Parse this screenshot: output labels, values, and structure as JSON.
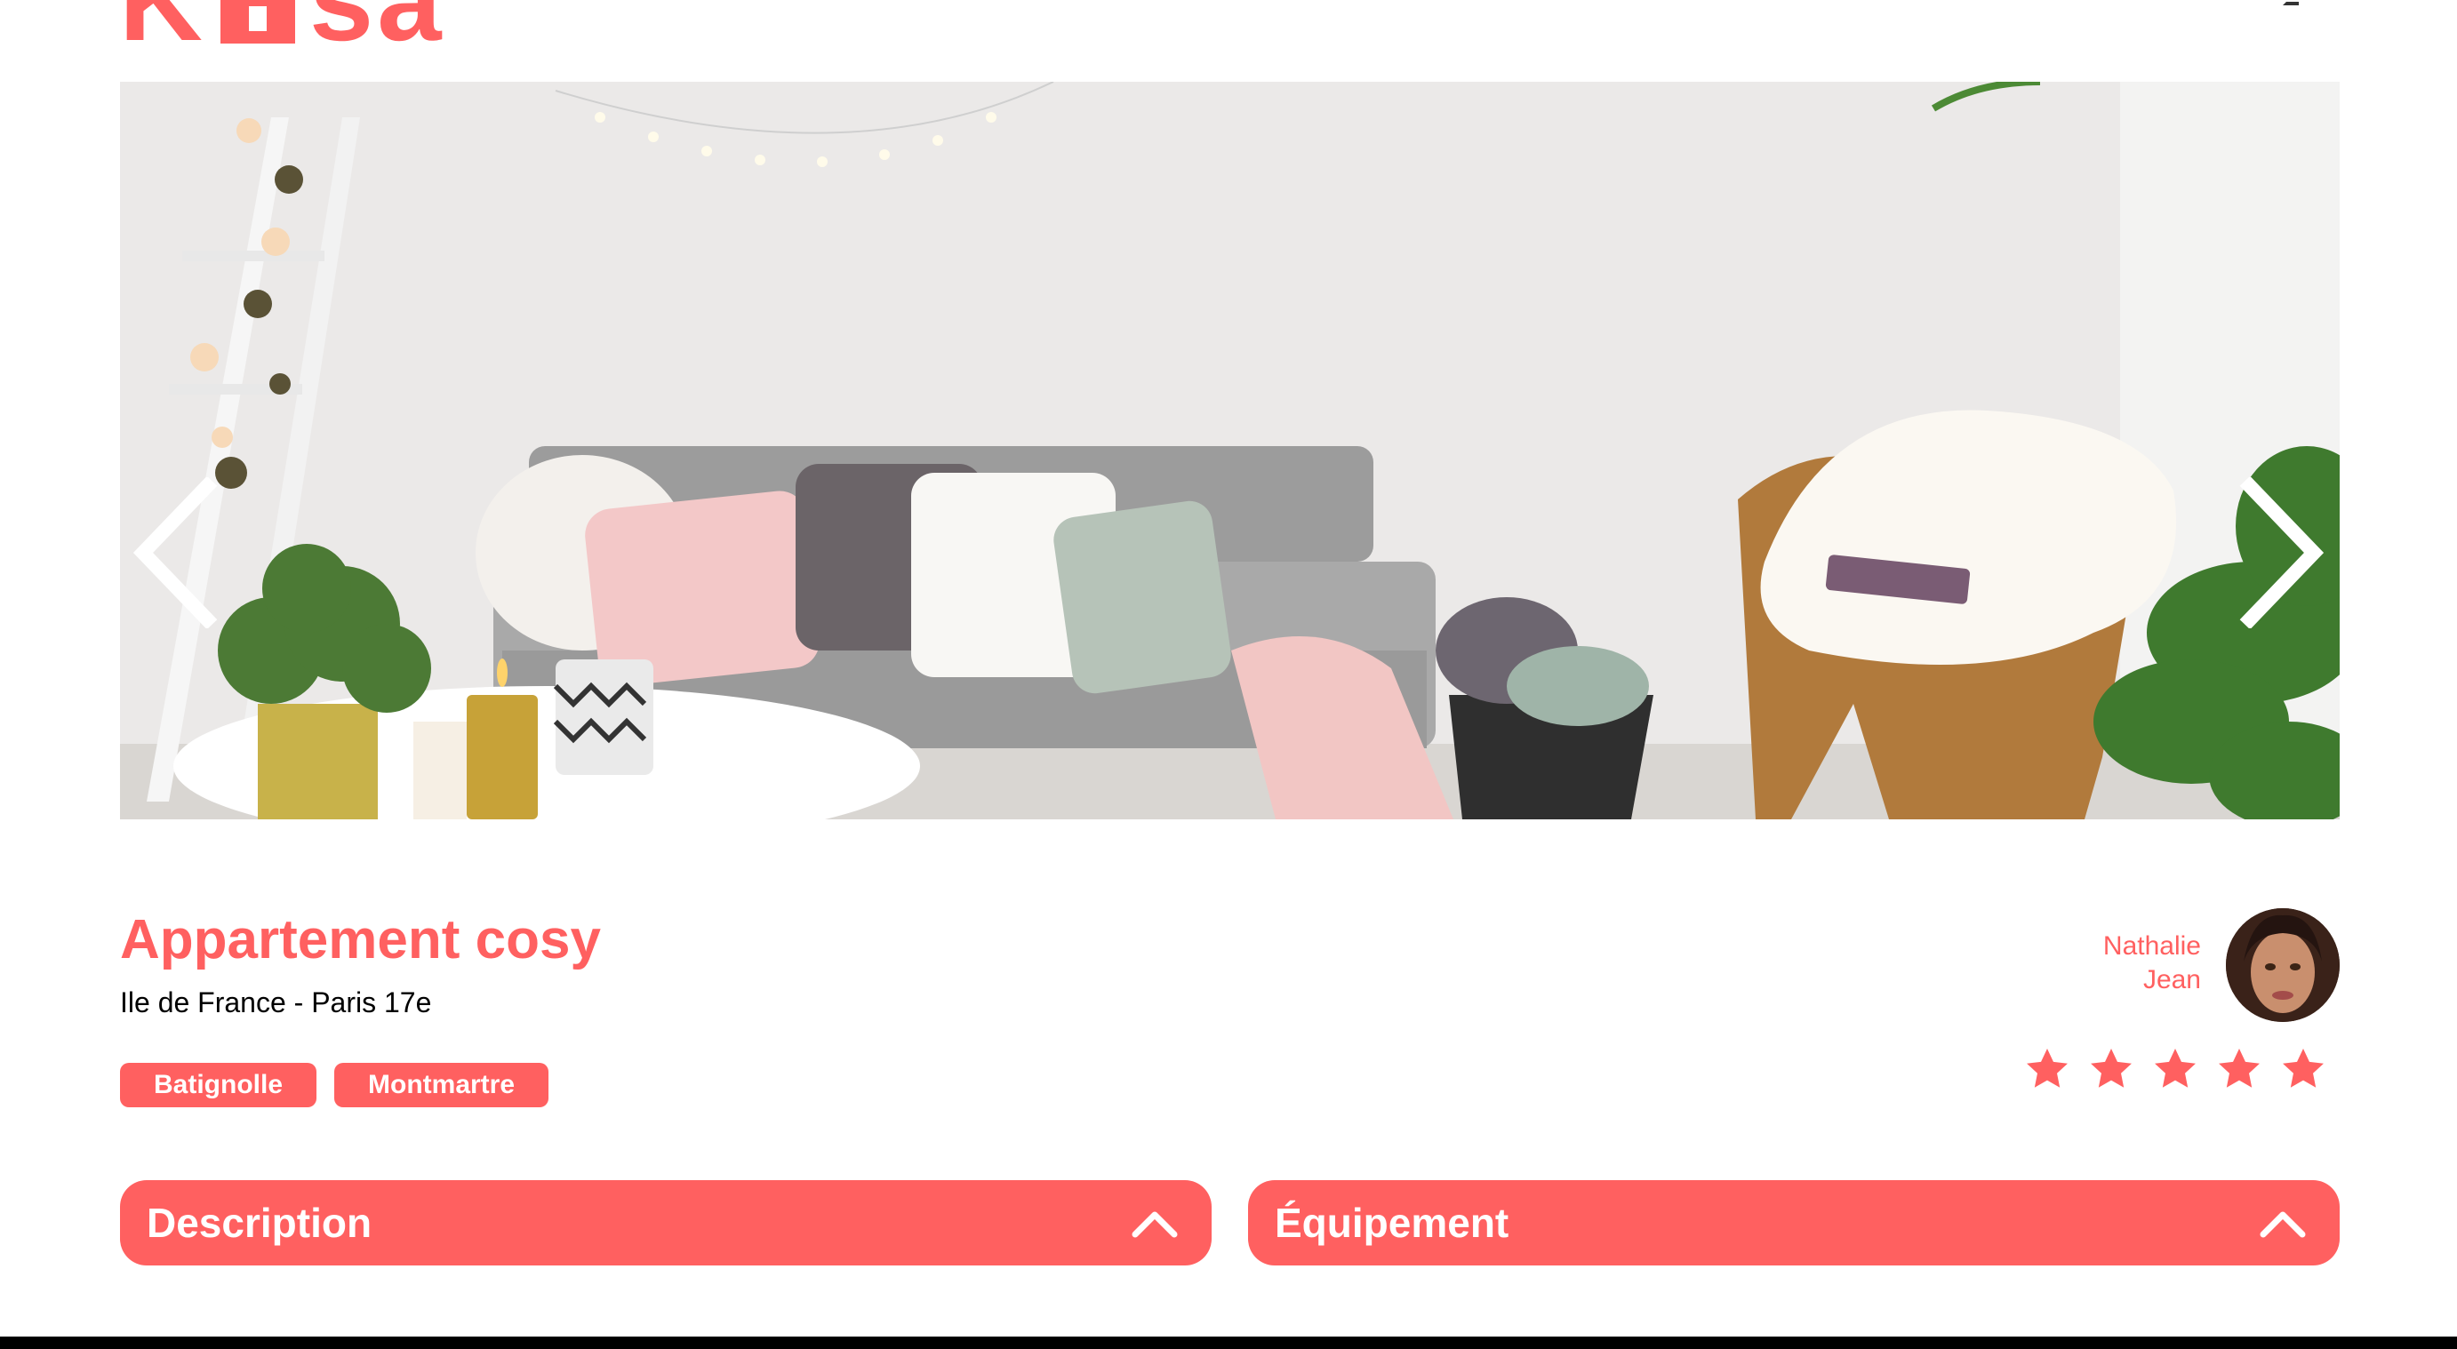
{
  "header": {
    "logo_text_start": "K",
    "logo_text_end": "sa"
  },
  "gallery": {
    "prev_label": "‹",
    "next_label": "›"
  },
  "listing": {
    "title": "Appartement cosy",
    "location": "Ile de France - Paris 17e",
    "tags": [
      "Batignolle",
      "Montmartre"
    ],
    "host": {
      "first_name": "Nathalie",
      "last_name": "Jean"
    },
    "rating": 5,
    "rating_max": 5
  },
  "collapses": {
    "description": "Description",
    "equipment": "Équipement"
  },
  "colors": {
    "accent": "#FF6060",
    "text": "#000000",
    "background": "#FFFFFF"
  },
  "icons": {
    "prev": "chevron-left-icon",
    "next": "chevron-right-icon",
    "collapse": "chevron-up-icon",
    "rating": "star-icon"
  }
}
